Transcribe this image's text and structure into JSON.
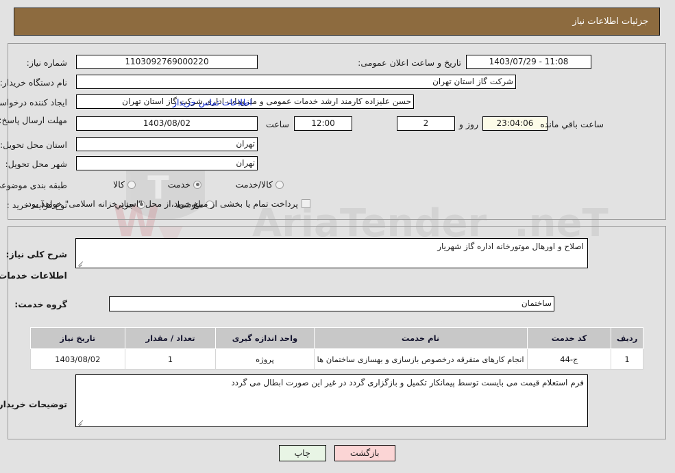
{
  "header": {
    "title": "جزئیات اطلاعات نیاز",
    "bar_color": "#8d6b3f"
  },
  "top_section": {
    "need_number": {
      "label": "شماره نیاز:",
      "value": "1103092769000220"
    },
    "announce_datetime": {
      "label": "تاریخ و ساعت اعلان عمومی:",
      "value": "11:08 - 1403/07/29"
    },
    "buyer_org": {
      "label": "نام دستگاه خریدار:",
      "value": "شرکت گاز استان تهران"
    },
    "request_creator": {
      "label": "ایجاد کننده درخواست:",
      "value": "حسن علیزاده کارمند ارشد خدمات عمومی و ملزومات اداری شرکت گاز استان تهران",
      "contact_link": "اطلاعات تماس خریدار"
    },
    "deadline": {
      "label": "مهلت ارسال پاسخ: تا تاریخ:",
      "date": "1403/08/02",
      "time_label": "ساعت",
      "time": "12:00",
      "days": "2",
      "days_label": "روز و",
      "countdown": "23:04:06",
      "countdown_label": "ساعت باقي مانده"
    },
    "delivery_province": {
      "label": "استان محل تحویل:",
      "value": "تهران"
    },
    "delivery_city": {
      "label": "شهر محل تحویل:",
      "value": "تهران"
    },
    "subject_category": {
      "label": "طبقه بندی موضوعی:",
      "options": [
        {
          "label": "کالا",
          "selected": false
        },
        {
          "label": "خدمت",
          "selected": true
        },
        {
          "label": "کالا/خدمت",
          "selected": false
        }
      ]
    },
    "purchase_process": {
      "label": "نوع فرآیند خرید :",
      "options": [
        {
          "label": "جزیي",
          "selected": true
        },
        {
          "label": "متوسط",
          "selected": false
        }
      ]
    },
    "treasury_checkbox": {
      "checked": false,
      "label": "پرداخت تمام یا بخشی از مبلغ خرید،از محل \"اسناد خزانه اسلامی\" خواهد بود."
    }
  },
  "bottom_section": {
    "general_description": {
      "label": "شرح کلی نیاز:",
      "value": "اصلاح و اورهال موتورخانه اداره گاز شهریار"
    },
    "services_heading": "اطلاعات خدمات مورد نیاز",
    "service_group": {
      "label": "گروه خدمت:",
      "value": "ساختمان"
    },
    "table": {
      "columns": [
        "ردیف",
        "کد خدمت",
        "نام خدمت",
        "واحد اندازه گیری",
        "تعداد / مقدار",
        "تاریخ نیاز"
      ],
      "rows": [
        {
          "row": "1",
          "code": "ج-44",
          "name": "انجام کارهای متفرقه درخصوص بازسازی و بهسازی ساختمان ها",
          "unit": "پروژه",
          "qty": "1",
          "need_date": "1403/08/02"
        }
      ]
    },
    "buyer_notes": {
      "label": "توضیحات خریدار:",
      "value": "فرم استعلام قیمت می بایست توسط پیمانکار تکمیل و بازگزاری گردد در غیر این صورت ابطال می گردد"
    }
  },
  "footer": {
    "print_label": "چاپ",
    "back_label": "بازگشت"
  }
}
